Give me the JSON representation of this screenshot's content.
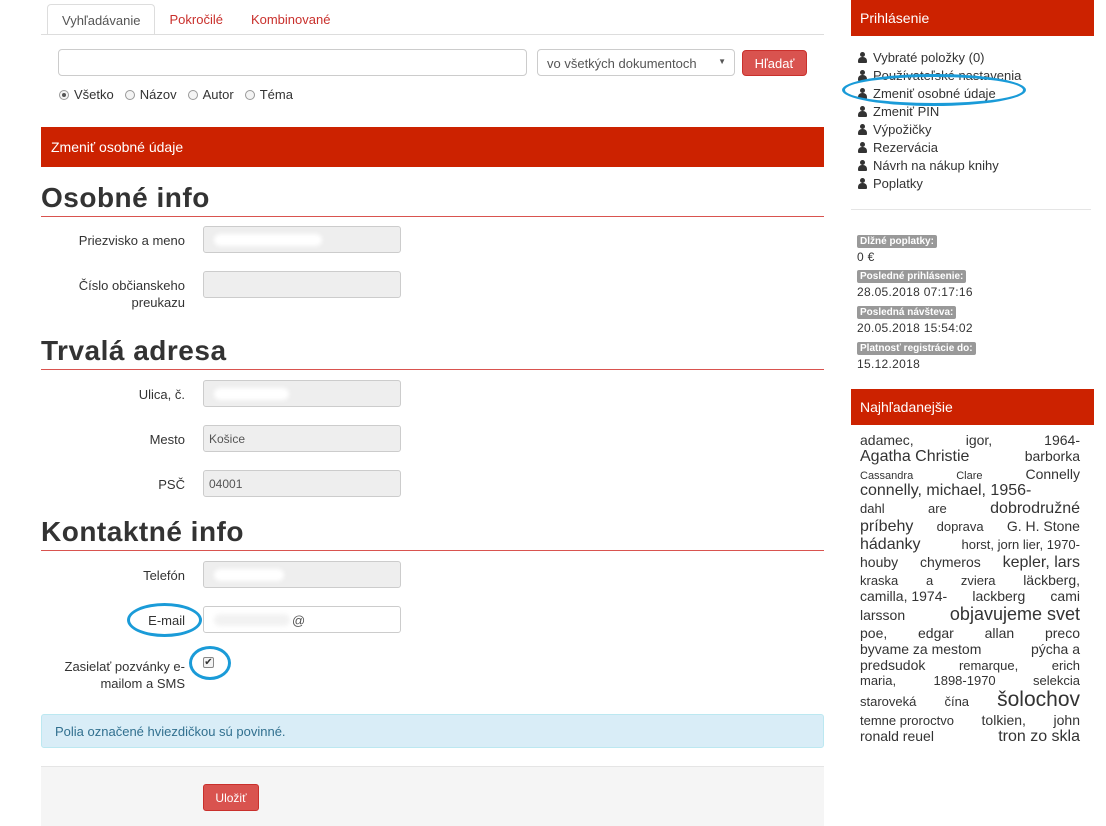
{
  "tabs": [
    {
      "label": "Vyhľadávanie"
    },
    {
      "label": "Pokročilé"
    },
    {
      "label": "Kombinované"
    }
  ],
  "search": {
    "query": "",
    "scope": "vo všetkých dokumentoch",
    "button": "Hľadať",
    "radios": [
      "Všetko",
      "Názov",
      "Autor",
      "Téma"
    ],
    "selected_radio": "Všetko"
  },
  "panel": {
    "title": "Zmeniť osobné údaje"
  },
  "sections": {
    "personal": "Osobné info",
    "address": "Trvalá adresa",
    "contact": "Kontaktné info"
  },
  "fields": {
    "name_label": "Priezvisko a meno",
    "id_label": "Číslo občianskeho preukazu",
    "street_label": "Ulica, č.",
    "city_label": "Mesto",
    "city_value": "Košice",
    "zip_label": "PSČ",
    "zip_value": "04001",
    "phone_label": "Telefón",
    "email_label": "E-mail",
    "email_value": "@",
    "invite_label": "Zasielať pozvánky e-mailom a SMS",
    "invite_checked": true
  },
  "info_text": "Polia označené hviezdičkou sú povinné.",
  "save_button": "Uložiť",
  "sidebar": {
    "login_title": "Prihlásenie",
    "menu": [
      "Vybraté položky (0)",
      "Používateľské nastavenia",
      "Zmeniť osobné údaje",
      "Zmeniť PIN",
      "Výpožičky",
      "Rezervácia",
      "Návrh na nákup knihy",
      "Poplatky"
    ],
    "stats": [
      {
        "label": "Dlžné poplatky:",
        "value": "0 €"
      },
      {
        "label": "Posledné prihlásenie:",
        "value": "28.05.2018 07:17:16"
      },
      {
        "label": "Posledná návšteva:",
        "value": "20.05.2018 15:54:02"
      },
      {
        "label": "Platnosť registrácie do:",
        "value": "15.12.2018"
      }
    ],
    "popular_title": "Najhľadanejšie",
    "tag_lines": [
      [
        {
          "t": "adamec,",
          "s": 3
        },
        {
          "t": "igor,",
          "s": 3
        },
        {
          "t": "1964-",
          "s": 3
        }
      ],
      [
        {
          "t": "Agatha Christie",
          "s": 4
        },
        {
          "t": "barborka",
          "s": 3
        }
      ],
      [
        {
          "t": "Cassandra",
          "s": 1
        },
        {
          "t": "Clare",
          "s": 1
        },
        {
          "t": "Connelly",
          "s": 3
        }
      ],
      [
        {
          "t": "connelly, michael, 1956-",
          "s": 4
        }
      ],
      [
        {
          "t": "dahl",
          "s": 2
        },
        {
          "t": "are",
          "s": 2
        },
        {
          "t": "dobrodružné",
          "s": 4
        }
      ],
      [
        {
          "t": "príbehy",
          "s": 4
        },
        {
          "t": "doprava",
          "s": 2
        },
        {
          "t": "G. H. Stone",
          "s": 3
        }
      ],
      [
        {
          "t": "hádanky",
          "s": 4
        },
        {
          "t": "horst, jorn lier, 1970-",
          "s": 2
        }
      ],
      [
        {
          "t": "houby",
          "s": 3
        },
        {
          "t": "chymeros",
          "s": 3
        },
        {
          "t": "kepler, lars",
          "s": 4
        }
      ],
      [
        {
          "t": "kraska",
          "s": 2
        },
        {
          "t": "a",
          "s": 2
        },
        {
          "t": "zviera",
          "s": 2
        },
        {
          "t": "läckberg,",
          "s": 3
        }
      ],
      [
        {
          "t": "camilla, 1974-",
          "s": 3
        },
        {
          "t": "lackberg",
          "s": 3
        },
        {
          "t": "cami",
          "s": 3
        }
      ],
      [
        {
          "t": "larsson",
          "s": 3
        },
        {
          "t": "objavujeme svet",
          "s": 5
        }
      ],
      [
        {
          "t": "poe,",
          "s": 3
        },
        {
          "t": "edgar",
          "s": 3
        },
        {
          "t": "allan",
          "s": 3
        },
        {
          "t": "preco",
          "s": 3
        }
      ],
      [
        {
          "t": "byvame za mestom",
          "s": 3
        },
        {
          "t": "pýcha a",
          "s": 3
        }
      ],
      [
        {
          "t": "predsudok",
          "s": 3
        },
        {
          "t": "remarque,",
          "s": 2
        },
        {
          "t": "erich",
          "s": 2
        }
      ],
      [
        {
          "t": "maria,",
          "s": 2
        },
        {
          "t": "1898-1970",
          "s": 2
        },
        {
          "t": "selekcia",
          "s": 2
        }
      ],
      [
        {
          "t": "staroveká",
          "s": 2
        },
        {
          "t": "čína",
          "s": 2
        },
        {
          "t": "šolochov",
          "s": 6
        }
      ],
      [
        {
          "t": "temne prorоctvo",
          "s": 2
        },
        {
          "t": "tolkien,",
          "s": 3
        },
        {
          "t": "john",
          "s": 3
        }
      ],
      [
        {
          "t": "ronald reuel",
          "s": 3
        },
        {
          "t": "tron zo skla",
          "s": 4
        }
      ]
    ]
  }
}
